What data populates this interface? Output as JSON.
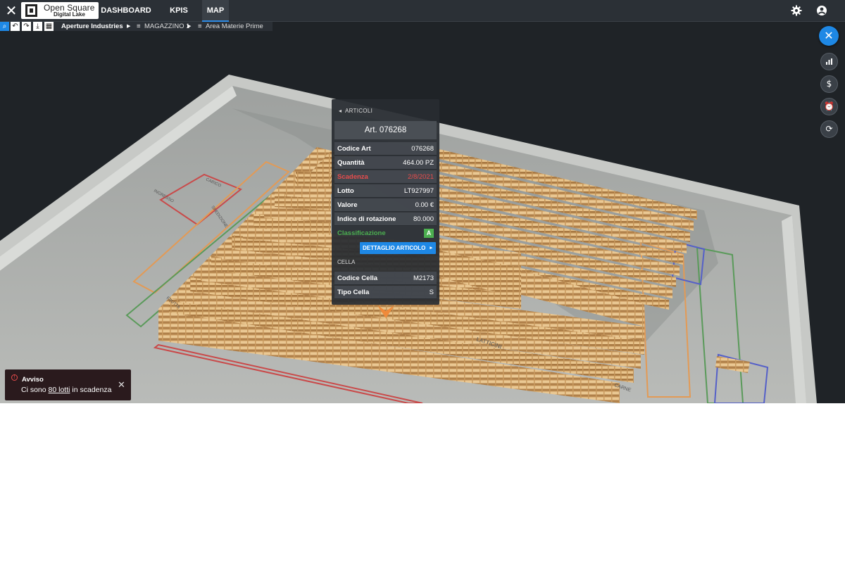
{
  "app": {
    "logo_line1": "Open Square",
    "logo_line2": "Digital Lake"
  },
  "nav": {
    "tabs": [
      {
        "label": "DASHBOARD"
      },
      {
        "label": "KPIS"
      },
      {
        "label": "MAP",
        "active": true
      }
    ]
  },
  "header_icons": [
    "close-icon",
    "gear-icon",
    "user-account-icon"
  ],
  "breadcrumb": {
    "tools": [
      "search-icon",
      "undo-icon",
      "redo-icon",
      "download-icon",
      "grid-icon"
    ],
    "items": [
      {
        "label": "Aperture Industries"
      },
      {
        "label": "MAGAZZINO 1"
      },
      {
        "label": "Area Materie Prime"
      }
    ]
  },
  "scene": {
    "zone_labels": [
      "INGRESSO",
      "CARICO",
      "SPEDIZIONE",
      "LATTICINI",
      "CARNE",
      "FRUTTA"
    ]
  },
  "right_tools": [
    "close-icon",
    "bar-chart-icon",
    "dollar-icon",
    "alarm-clock-icon",
    "refresh-icon"
  ],
  "popup": {
    "back_label": "ARTICOLI",
    "article_title": "Art. 076268",
    "rows": [
      {
        "key": "Codice Art",
        "value": "076268"
      },
      {
        "key": "Quantità",
        "value": "464.00 PZ"
      },
      {
        "key": "Scadenza",
        "value": "2/8/2021",
        "status": "red"
      },
      {
        "key": "Lotto",
        "value": "LT927997"
      },
      {
        "key": "Valore",
        "value": "0.00 €"
      },
      {
        "key": "Indice di rotazione",
        "value": "80.000"
      },
      {
        "key": "Classificazione",
        "value": "A",
        "status": "green"
      }
    ],
    "detail_button": "DETTAGLIO ARTICOLO",
    "cella_header": "CELLA",
    "cella_rows": [
      {
        "key": "Codice Cella",
        "value": "M2173"
      },
      {
        "key": "Tipo Cella",
        "value": "S"
      }
    ],
    "colors": {
      "accent": "#1e88e5",
      "warning": "#e84c4c",
      "class_a": "#4caf50"
    }
  },
  "toast": {
    "title": "Avviso",
    "msg_before": "Ci sono ",
    "msg_link": "80 lotti",
    "msg_after": " in scadenza"
  }
}
